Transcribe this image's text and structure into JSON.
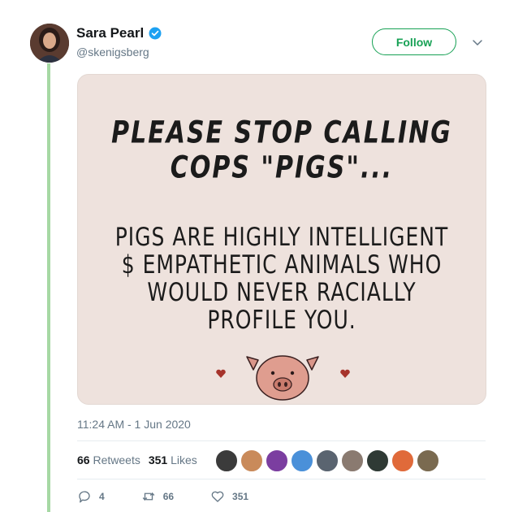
{
  "tweet": {
    "display_name": "Sara Pearl",
    "handle": "@skenigsberg",
    "follow_label": "Follow",
    "timestamp": "11:24 AM - 1 Jun 2020"
  },
  "image_text": {
    "heading_line1": "PLEASE STOP CALLING",
    "heading_line2": "COPS \"PIGS\"...",
    "body_line1": "PIGS ARE HIGHLY INTELLIGENT",
    "body_line2": "$ EMPATHETIC ANIMALS WHO",
    "body_line3": "WOULD NEVER RACIALLY",
    "body_line4": "PROFILE YOU."
  },
  "stats": {
    "retweets_count": "66",
    "retweets_label": "Retweets",
    "likes_count": "351",
    "likes_label": "Likes"
  },
  "actions": {
    "replies": "4",
    "retweets": "66",
    "likes": "351"
  },
  "icons": [
    "verified-badge-icon",
    "chevron-down-icon",
    "reply-icon",
    "retweet-icon",
    "heart-icon"
  ],
  "colors": {
    "follow_accent": "#17a155",
    "verified_blue": "#1da1f2",
    "thread_line": "#a6d8a4",
    "image_bg": "#eee2dd",
    "muted_text": "#657786"
  }
}
